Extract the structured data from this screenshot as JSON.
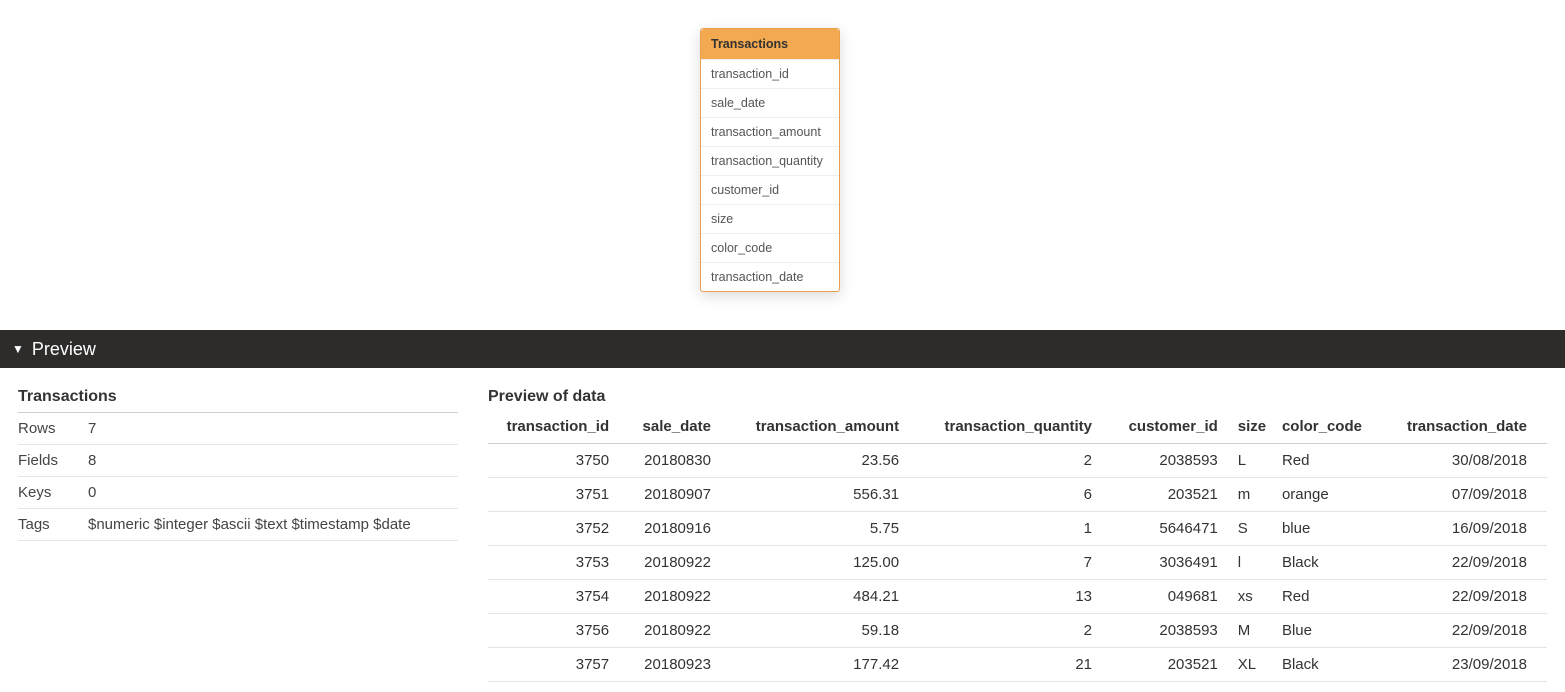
{
  "card": {
    "title": "Transactions",
    "fields": [
      "transaction_id",
      "sale_date",
      "transaction_amount",
      "transaction_quantity",
      "customer_id",
      "size",
      "color_code",
      "transaction_date"
    ]
  },
  "preview": {
    "bar_label": "Preview",
    "meta_title": "Transactions",
    "meta": {
      "rows_label": "Rows",
      "rows_value": "7",
      "fields_label": "Fields",
      "fields_value": "8",
      "keys_label": "Keys",
      "keys_value": "0",
      "tags_label": "Tags",
      "tags_value": "$numeric $integer $ascii $text $timestamp $date"
    },
    "data_title": "Preview of data",
    "columns": [
      "transaction_id",
      "sale_date",
      "transaction_amount",
      "transaction_quantity",
      "customer_id",
      "size",
      "color_code",
      "transaction_date"
    ],
    "col_numeric": [
      true,
      true,
      true,
      true,
      true,
      false,
      false,
      true
    ],
    "rows": [
      [
        "3750",
        "20180830",
        "23.56",
        "2",
        "2038593",
        "L",
        "Red",
        "30/08/2018"
      ],
      [
        "3751",
        "20180907",
        "556.31",
        "6",
        "203521",
        "m",
        "orange",
        "07/09/2018"
      ],
      [
        "3752",
        "20180916",
        "5.75",
        "1",
        "5646471",
        "S",
        "blue",
        "16/09/2018"
      ],
      [
        "3753",
        "20180922",
        "125.00",
        "7",
        "3036491",
        "l",
        "Black",
        "22/09/2018"
      ],
      [
        "3754",
        "20180922",
        "484.21",
        "13",
        "049681",
        "xs",
        "Red",
        "22/09/2018"
      ],
      [
        "3756",
        "20180922",
        "59.18",
        "2",
        "2038593",
        "M",
        "Blue",
        "22/09/2018"
      ],
      [
        "3757",
        "20180923",
        "177.42",
        "21",
        "203521",
        "XL",
        "Black",
        "23/09/2018"
      ]
    ]
  }
}
